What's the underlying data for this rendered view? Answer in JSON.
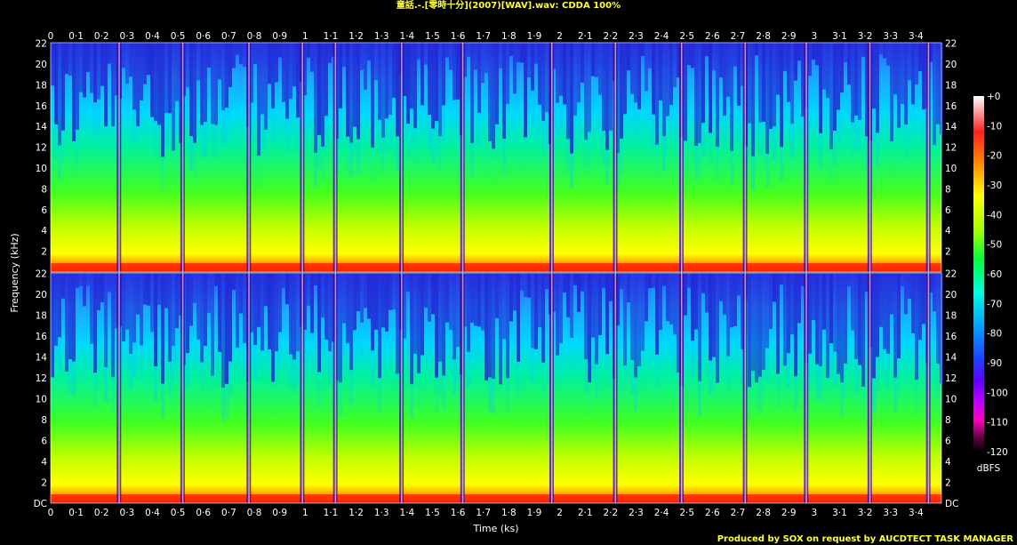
{
  "title": "童話.-.[零時十分](2007)[WAV].wav: CDDA 100%",
  "credit": "Produced by SOX on request by AUCDTECT TASK MANAGER",
  "chart_data": {
    "type": "heatmap",
    "xlabel": "Time (ks)",
    "ylabel": "Frequency (kHz)",
    "xlim": [
      0,
      3.5
    ],
    "ylim": [
      0,
      22.05
    ],
    "x_ticks": [
      "0",
      "0·1",
      "0·2",
      "0·3",
      "0·4",
      "0·5",
      "0·6",
      "0·7",
      "0·8",
      "0·9",
      "1",
      "1·1",
      "1·2",
      "1·3",
      "1·4",
      "1·5",
      "1·6",
      "1·7",
      "1·8",
      "1·9",
      "2",
      "2·1",
      "2·2",
      "2·3",
      "2·4",
      "2·5",
      "2·6",
      "2·7",
      "2·8",
      "2·9",
      "3",
      "3·1",
      "3·2",
      "3·3",
      "3·4"
    ],
    "y_ticks": [
      "DC",
      "2",
      "4",
      "6",
      "8",
      "10",
      "12",
      "14",
      "16",
      "18",
      "20",
      "22"
    ],
    "channels": 2,
    "track_boundaries_ks": [
      0.27,
      0.52,
      0.78,
      0.99,
      1.12,
      1.38,
      1.62,
      1.97,
      2.22,
      2.48,
      2.73,
      2.97,
      3.22,
      3.45
    ],
    "colorbar": {
      "label": "dBFS",
      "ticks": [
        "+0",
        "-10",
        "-20",
        "-30",
        "-40",
        "-50",
        "-60",
        "-70",
        "-80",
        "-90",
        "-100",
        "-110",
        "-120"
      ],
      "range": [
        -120,
        0
      ]
    },
    "colors": {
      "background": "#000000",
      "title": "#ffff33",
      "text": "#ffffff"
    }
  }
}
